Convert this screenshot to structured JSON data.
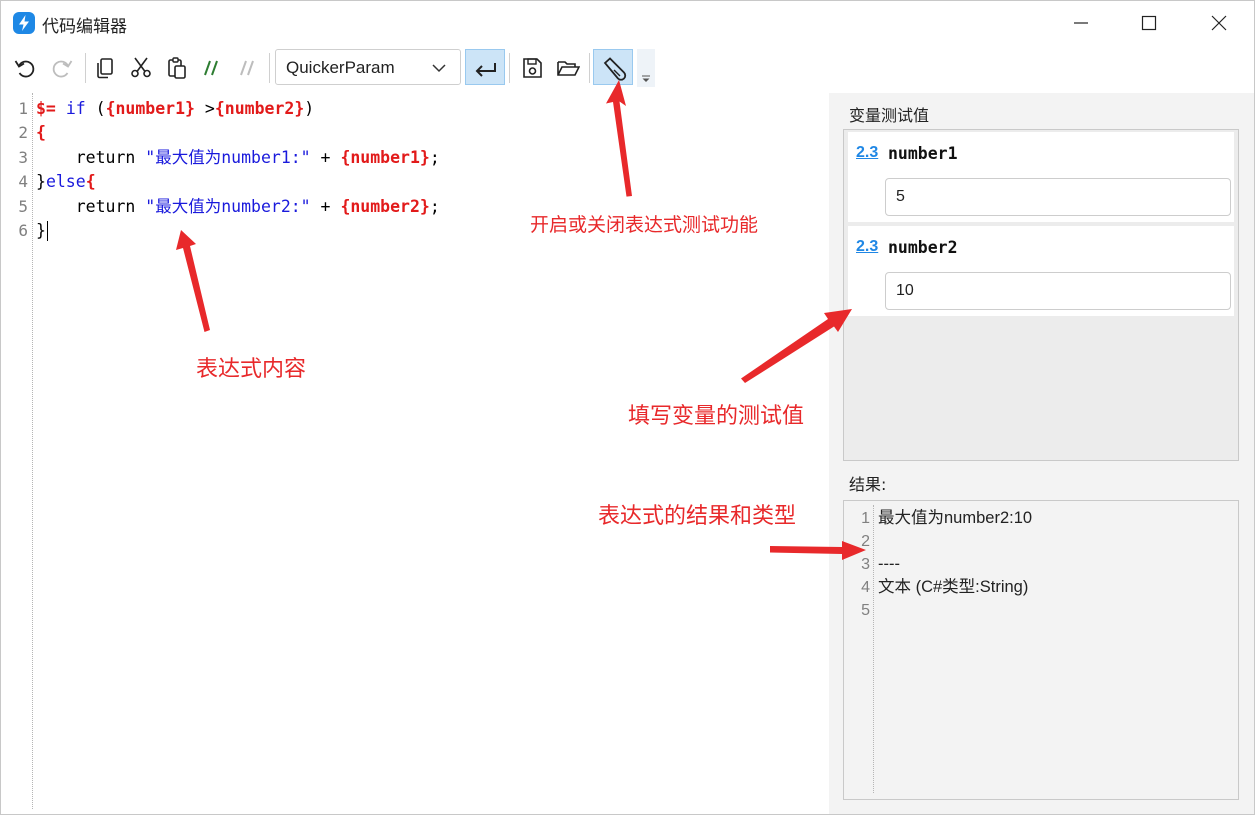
{
  "window": {
    "title": "代码编辑器"
  },
  "toolbar": {
    "param_combo_value": "QuickerParam"
  },
  "editor": {
    "line_numbers": [
      "1",
      "2",
      "3",
      "4",
      "5",
      "6"
    ],
    "lines": [
      [
        {
          "t": "$= ",
          "c": "red"
        },
        {
          "t": "if",
          "c": "kw"
        },
        {
          "t": " (",
          "c": ""
        },
        {
          "t": "{number1}",
          "c": "red"
        },
        {
          "t": " >",
          "c": ""
        },
        {
          "t": "{number2}",
          "c": "red"
        },
        {
          "t": ")",
          "c": ""
        }
      ],
      [
        {
          "t": "{",
          "c": "red"
        }
      ],
      [
        {
          "t": "    return ",
          "c": ""
        },
        {
          "t": "\"最大值为number1:\"",
          "c": "str"
        },
        {
          "t": " + ",
          "c": ""
        },
        {
          "t": "{number1}",
          "c": "red"
        },
        {
          "t": ";",
          "c": ""
        }
      ],
      [
        {
          "t": "}",
          "c": ""
        },
        {
          "t": "else",
          "c": "kw"
        },
        {
          "t": "{",
          "c": "red"
        }
      ],
      [
        {
          "t": "    return ",
          "c": ""
        },
        {
          "t": "\"最大值为number2:\"",
          "c": "str"
        },
        {
          "t": " + ",
          "c": ""
        },
        {
          "t": "{number2}",
          "c": "red"
        },
        {
          "t": ";",
          "c": ""
        }
      ],
      [
        {
          "t": "}",
          "c": ""
        }
      ]
    ]
  },
  "variables": {
    "label": "变量测试值",
    "items": [
      {
        "type_icon": "2.3",
        "name": "number1",
        "value": "5"
      },
      {
        "type_icon": "2.3",
        "name": "number2",
        "value": "10"
      }
    ]
  },
  "result": {
    "label": "结果:",
    "line_numbers": [
      "1",
      "2",
      "3",
      "4",
      "5"
    ],
    "lines": [
      "最大值为number2:10",
      "",
      "----",
      "文本 (C#类型:String)",
      ""
    ]
  },
  "annotations": {
    "toggle_test": "开启或关闭表达式测试功能",
    "expression_content": "表达式内容",
    "fill_test_values": "填写变量的测试值",
    "result_and_type": "表达式的结果和类型"
  },
  "colors": {
    "annotation": "#e8292b",
    "accent": "#1e88e5"
  }
}
